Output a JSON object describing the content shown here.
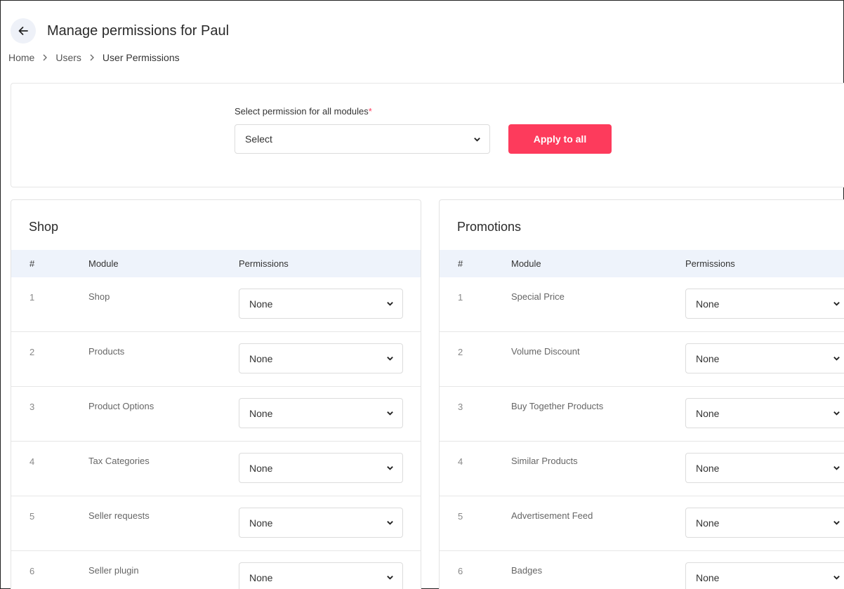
{
  "header": {
    "title": "Manage permissions for Paul",
    "back_icon": "arrow-left-icon"
  },
  "breadcrumb": [
    {
      "label": "Home"
    },
    {
      "label": "Users"
    },
    {
      "label": "User Permissions"
    }
  ],
  "bulk": {
    "label": "Select permission for all modules",
    "required_mark": "*",
    "select_value": "Select",
    "apply_label": "Apply to all"
  },
  "colors": {
    "accent": "#fd3b5c",
    "table_header_bg": "#eef3fb",
    "back_button_bg": "#eef1f8"
  },
  "panels": [
    {
      "title": "Shop",
      "columns": [
        "#",
        "Module",
        "Permissions"
      ],
      "rows": [
        {
          "num": "1",
          "module": "Shop",
          "permission": "None"
        },
        {
          "num": "2",
          "module": "Products",
          "permission": "None"
        },
        {
          "num": "3",
          "module": "Product Options",
          "permission": "None"
        },
        {
          "num": "4",
          "module": "Tax Categories",
          "permission": "None"
        },
        {
          "num": "5",
          "module": "Seller requests",
          "permission": "None"
        },
        {
          "num": "6",
          "module": "Seller plugin",
          "permission": "None"
        }
      ]
    },
    {
      "title": "Promotions",
      "columns": [
        "#",
        "Module",
        "Permissions"
      ],
      "rows": [
        {
          "num": "1",
          "module": "Special Price",
          "permission": "None"
        },
        {
          "num": "2",
          "module": "Volume Discount",
          "permission": "None"
        },
        {
          "num": "3",
          "module": "Buy Together Products",
          "permission": "None"
        },
        {
          "num": "4",
          "module": "Similar Products",
          "permission": "None"
        },
        {
          "num": "5",
          "module": "Advertisement Feed",
          "permission": "None"
        },
        {
          "num": "6",
          "module": "Badges",
          "permission": "None"
        }
      ]
    }
  ]
}
